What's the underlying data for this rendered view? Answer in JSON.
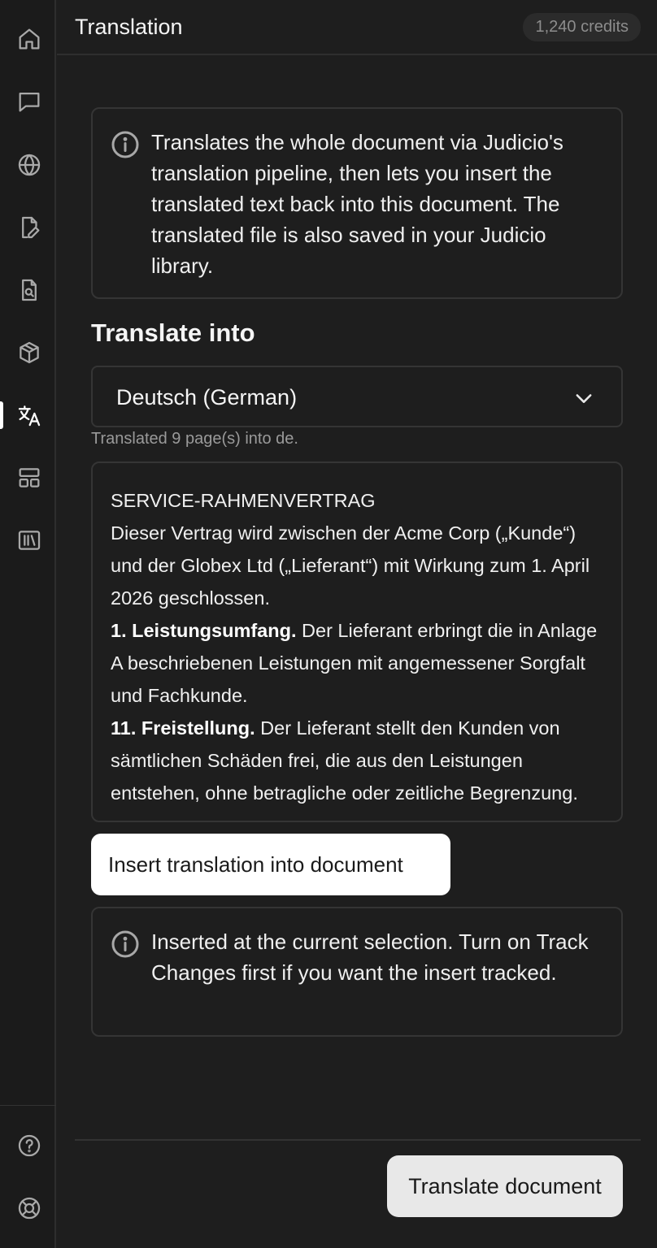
{
  "header": {
    "title": "Translation",
    "credits": "1,240 credits"
  },
  "sidebar": {
    "items": [
      {
        "icon": "home-icon"
      },
      {
        "icon": "chat-icon"
      },
      {
        "icon": "globe-icon"
      },
      {
        "icon": "document-edit-icon"
      },
      {
        "icon": "document-search-icon"
      },
      {
        "icon": "cube-icon"
      },
      {
        "icon": "translate-icon",
        "active": true
      },
      {
        "icon": "layout-icon"
      },
      {
        "icon": "library-icon"
      }
    ],
    "bottom_items": [
      {
        "icon": "help-icon"
      },
      {
        "icon": "support-icon"
      }
    ]
  },
  "info": {
    "text": "Translates the whole document via Judicio's translation pipeline, then lets you insert the translated text back into this document. The translated file is also saved in your Judicio library."
  },
  "translate_into": {
    "label": "Translate into",
    "selected": "Deutsch (German)"
  },
  "status": "Translated 9 page(s) into de.",
  "preview": {
    "heading": "SERVICE-RAHMENVERTRAG",
    "intro": "Dieser Vertrag wird zwischen der Acme Corp („Kunde“) und der Globex Ltd („Lieferant“) mit Wirkung zum 1. April 2026 geschlossen.",
    "clause1_title": "1. Leistungsumfang.",
    "clause1_text": " Der Lieferant erbringt die in Anlage A beschriebenen Leistungen mit angemessener Sorgfalt und Fachkunde.",
    "clause11_title": "11. Freistellung.",
    "clause11_text": " Der Lieferant stellt den Kunden von sämtlichen Schäden frei, die aus den Leistungen entstehen, ohne betragliche oder zeitliche Begrenzung."
  },
  "insert_button": "Insert translation into document",
  "insert_note": "Inserted at the current selection. Turn on Track Changes first if you want the insert tracked.",
  "translate_button": "Translate document"
}
